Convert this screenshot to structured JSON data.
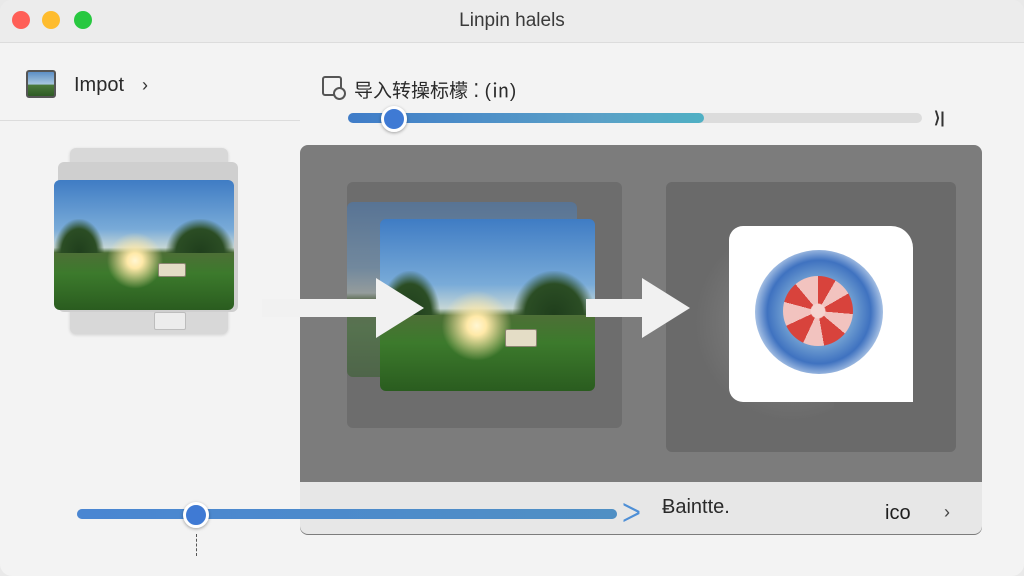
{
  "window": {
    "title": "Linpin halels"
  },
  "sidebar": {
    "import_label": "Impot",
    "import_chevron": "›",
    "import_icon": "image-icon"
  },
  "toolbar": {
    "convert_label": "导入转操标檬 ⁚ (㏌)",
    "convert_icon": "convert-icon",
    "slider_end_icon": "⟩|",
    "slider_value_percent": 8,
    "slider_fill_percent": 62
  },
  "preview": {
    "format_icon_text": "ᐳ",
    "format_icon_label": "Ƀaintte.",
    "format_label": "ico",
    "format_chevron": "›"
  },
  "bottom_slider": {
    "value_percent": 22,
    "end_chevron": "ᐳ"
  },
  "colors": {
    "accent": "#3f7ad4",
    "traffic_red": "#ff5f57",
    "traffic_yellow": "#febc2e",
    "traffic_green": "#28c840"
  }
}
